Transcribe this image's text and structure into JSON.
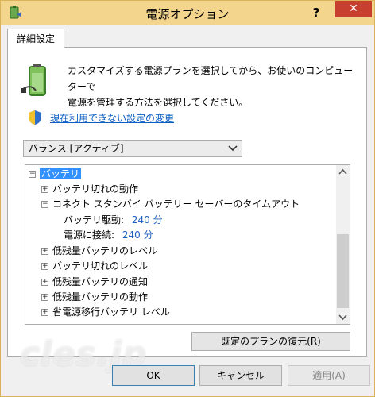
{
  "window": {
    "title": "電源オプション",
    "help_label": "?",
    "close_label": "✕"
  },
  "tab": {
    "label": "詳細設定"
  },
  "description": {
    "line1": "カスタマイズする電源プランを選択してから、お使いのコンピューターで",
    "line2": "電源を管理する方法を選択してください。"
  },
  "link": {
    "label": "現在利用できない設定の変更"
  },
  "plan_select": {
    "value": "バランス [アクティブ]"
  },
  "tree": {
    "root": "バッテリ",
    "items": [
      {
        "label": "バッテリ切れの動作",
        "toggle": "+"
      },
      {
        "label": "コネクト スタンバイ バッテリー セーバーのタイムアウト",
        "toggle": "−"
      },
      {
        "label": "低残量バッテリのレベル",
        "toggle": "+"
      },
      {
        "label": "バッテリ切れのレベル",
        "toggle": "+"
      },
      {
        "label": "低残量バッテリの通知",
        "toggle": "+"
      },
      {
        "label": "低残量バッテリの動作",
        "toggle": "+"
      },
      {
        "label": "省電源移行バッテリ レベル",
        "toggle": "+"
      }
    ],
    "subitems": [
      {
        "label": "バッテリ駆動:",
        "value": "240 分"
      },
      {
        "label": "電源に接続:",
        "value": "240 分"
      }
    ],
    "root_toggle": "−"
  },
  "buttons": {
    "restore": "既定のプランの復元(R)",
    "ok": "OK",
    "cancel": "キャンセル",
    "apply": "適用(A)"
  },
  "watermark": "cles.jp",
  "colors": {
    "titlebar": "#f4d58e",
    "close": "#c7402f",
    "link": "#0b5ec2",
    "selection": "#3390ff"
  }
}
